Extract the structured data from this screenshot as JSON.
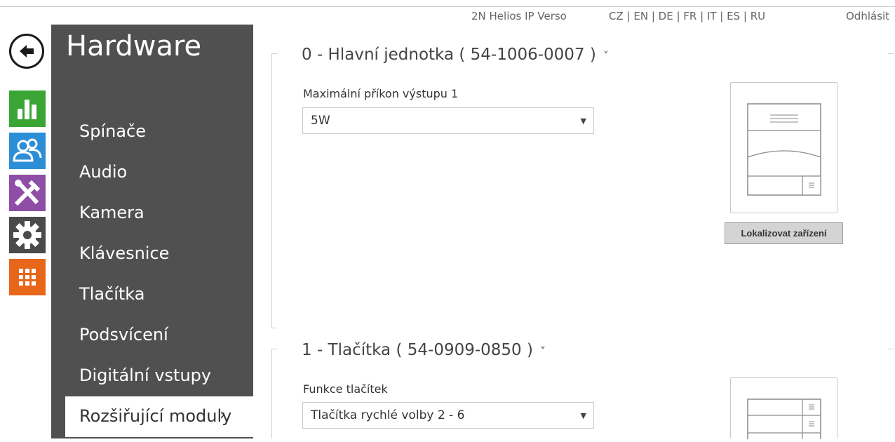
{
  "topbar": {
    "product": "2N Helios IP Verso",
    "languages": [
      "CZ",
      "EN",
      "DE",
      "FR",
      "IT",
      "ES",
      "RU"
    ],
    "logout": "Odhlásit"
  },
  "rail": {
    "icons": [
      "back-arrow-icon",
      "status-chart-icon",
      "users-icon",
      "tools-icon",
      "gear-icon",
      "grid-icon"
    ],
    "colors": {
      "status": "#3aa535",
      "users": "#2c8ed6",
      "tools": "#8e4ea8",
      "gear": "#4a4a4a",
      "grid": "#e8661a"
    }
  },
  "menu": {
    "title": "Hardware",
    "items": [
      {
        "label": "Spínače"
      },
      {
        "label": "Audio"
      },
      {
        "label": "Kamera"
      },
      {
        "label": "Klávesnice"
      },
      {
        "label": "Tlačítka"
      },
      {
        "label": "Podsvícení"
      },
      {
        "label": "Digitální vstupy"
      },
      {
        "label": "Rozšiřující moduly",
        "active": true,
        "chevron": "›"
      }
    ]
  },
  "sections": [
    {
      "title": "0 - Hlavní jednotka ( 54-1006-0007 )",
      "chevron": "˅",
      "field_label": "Maximální příkon výstupu 1",
      "select_value": "5W",
      "locate_button": "Lokalizovat zařízení"
    },
    {
      "title": "1 - Tlačítka ( 54-0909-0850 )",
      "chevron": "˅",
      "field_label": "Funkce tlačítek",
      "select_value": "Tlačítka rychlé volby 2 - 6"
    }
  ]
}
